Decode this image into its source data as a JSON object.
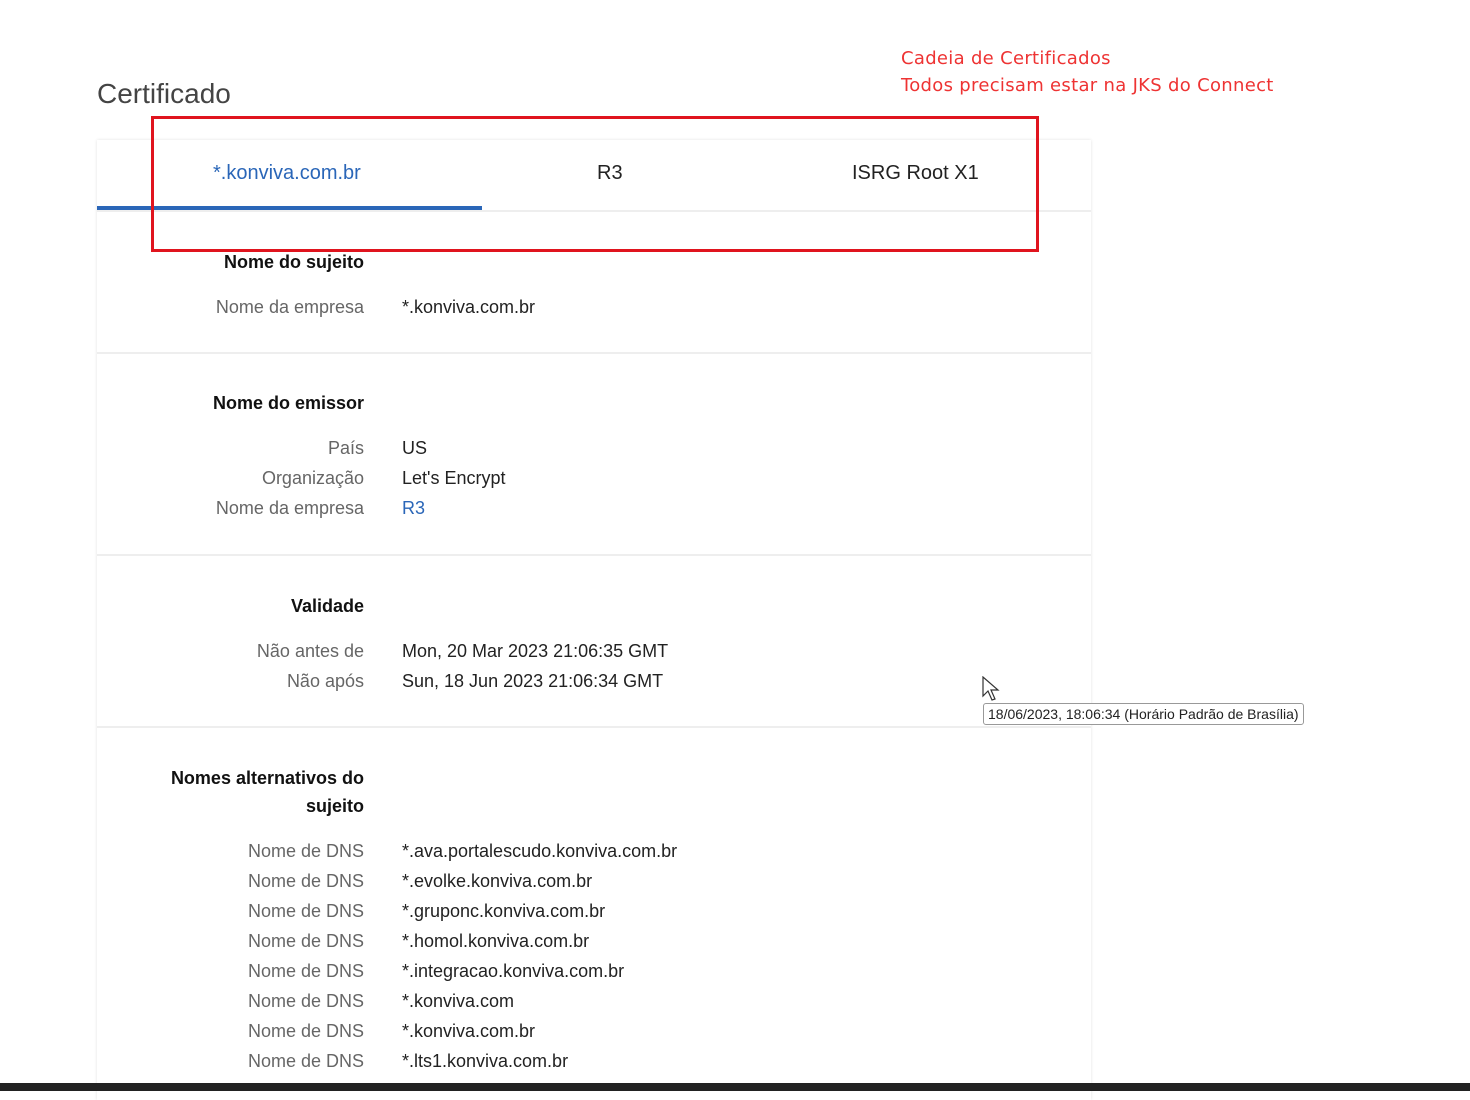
{
  "page_title": "Certificado",
  "annotation": {
    "line1": "Cadeia de Certificados",
    "line2": "Todos precisam estar na JKS do Connect"
  },
  "tabs": [
    {
      "label": "*.konviva.com.br"
    },
    {
      "label": "R3"
    },
    {
      "label": "ISRG Root X1"
    }
  ],
  "subject": {
    "heading": "Nome do sujeito",
    "rows": [
      {
        "label": "Nome da empresa",
        "value": "*.konviva.com.br"
      }
    ]
  },
  "issuer": {
    "heading": "Nome do emissor",
    "rows": [
      {
        "label": "País",
        "value": "US"
      },
      {
        "label": "Organização",
        "value": "Let's Encrypt"
      },
      {
        "label": "Nome da empresa",
        "value": "R3"
      }
    ]
  },
  "validity": {
    "heading": "Validade",
    "rows": [
      {
        "label": "Não antes de",
        "value": "Mon, 20 Mar 2023 21:06:35 GMT"
      },
      {
        "label": "Não após",
        "value": "Sun, 18 Jun 2023 21:06:34 GMT"
      }
    ]
  },
  "tooltip": "18/06/2023, 18:06:34 (Horário Padrão de Brasília)",
  "san": {
    "heading_line1": "Nomes alternativos do",
    "heading_line2": "sujeito",
    "rows": [
      {
        "label": "Nome de DNS",
        "value": "*.ava.portalescudo.konviva.com.br"
      },
      {
        "label": "Nome de DNS",
        "value": "*.evolke.konviva.com.br"
      },
      {
        "label": "Nome de DNS",
        "value": "*.gruponc.konviva.com.br"
      },
      {
        "label": "Nome de DNS",
        "value": "*.homol.konviva.com.br"
      },
      {
        "label": "Nome de DNS",
        "value": "*.integracao.konviva.com.br"
      },
      {
        "label": "Nome de DNS",
        "value": "*.konviva.com"
      },
      {
        "label": "Nome de DNS",
        "value": "*.konviva.com.br"
      },
      {
        "label": "Nome de DNS",
        "value": "*.lts1.konviva.com.br"
      }
    ]
  }
}
